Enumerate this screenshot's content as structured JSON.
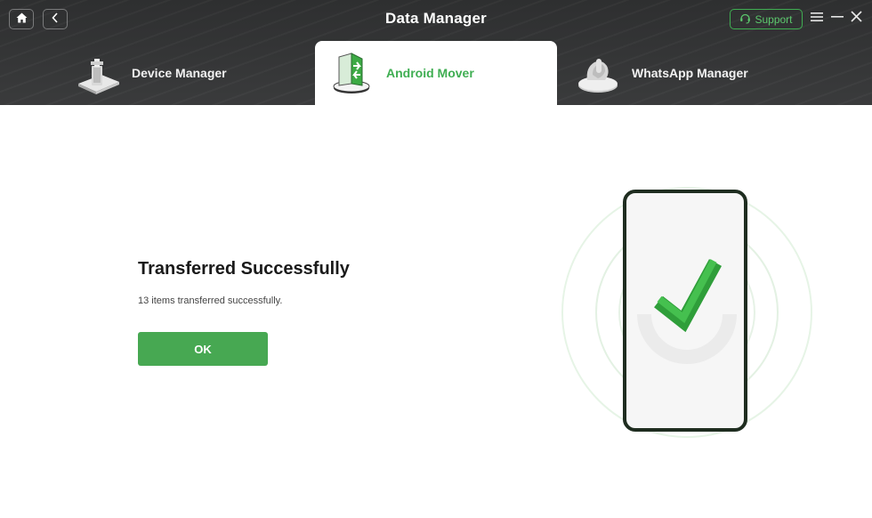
{
  "header": {
    "title": "Data Manager",
    "support_label": "Support"
  },
  "icons": {
    "home": "home-icon",
    "back": "chevron-left-icon",
    "support": "headset-icon",
    "menu": "hamburger-menu-icon",
    "minimize": "minimize-icon",
    "close": "close-icon"
  },
  "tabs": [
    {
      "label": "Device Manager",
      "icon": "device-manager-icon",
      "active": false
    },
    {
      "label": "Android Mover",
      "icon": "android-mover-icon",
      "active": true
    },
    {
      "label": "WhatsApp Manager",
      "icon": "whatsapp-manager-icon",
      "active": false
    }
  ],
  "result": {
    "title": "Transferred Successfully",
    "description": "13 items transferred successfully.",
    "ok_label": "OK"
  },
  "colors": {
    "accent": "#47a852",
    "topbar": "#333435",
    "check": "#3aad3f"
  }
}
